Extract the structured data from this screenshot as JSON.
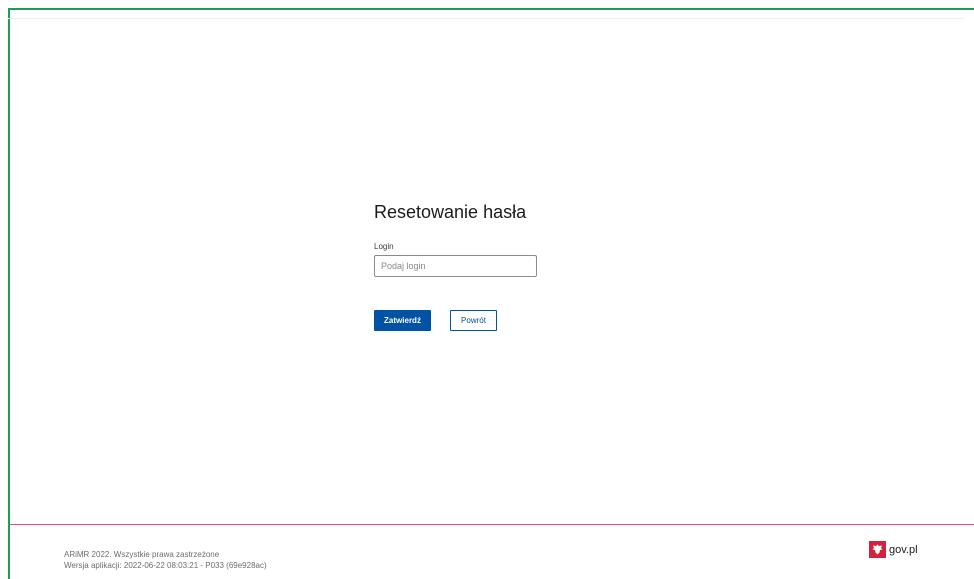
{
  "page": {
    "title": "Resetowanie hasła"
  },
  "form": {
    "login_label": "Login",
    "login_placeholder": "Podaj login",
    "login_value": "",
    "submit_label": "Zatwierdź",
    "back_label": "Powrót"
  },
  "footer": {
    "copyright": "ARiMR 2022. Wszystkie prawa zastrzeżone",
    "version": "Wersja aplikacji: 2022-06-22 08:03:21 - P033 (69e928ac)",
    "gov_logo_text": "gov.pl",
    "gov_logo_icon": "polish-eagle-icon"
  },
  "colors": {
    "frame_border": "#1f9d55",
    "footer_divider": "#e4507c",
    "primary_button": "#0052a5",
    "emblem_background": "#d4213d"
  }
}
